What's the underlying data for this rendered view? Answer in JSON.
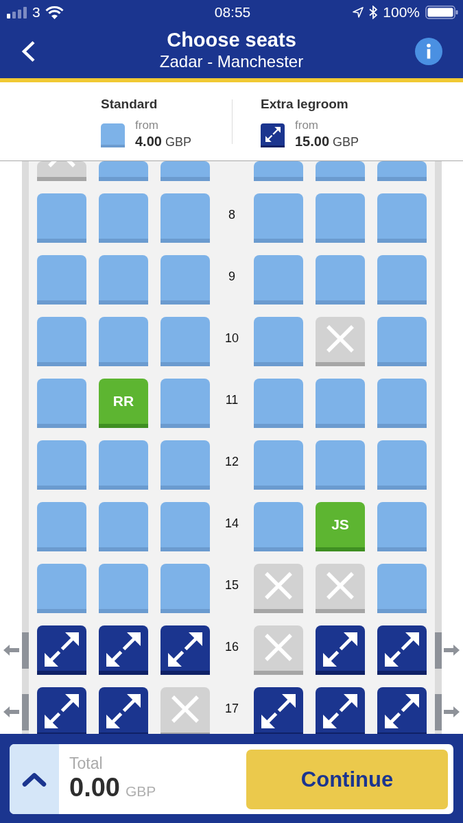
{
  "status_bar": {
    "carrier": "3",
    "time": "08:55",
    "battery": "100%"
  },
  "header": {
    "title": "Choose seats",
    "subtitle": "Zadar - Manchester"
  },
  "legend": [
    {
      "kind": "standard",
      "label": "Standard",
      "from": "from",
      "price": "4.00",
      "currency": "GBP"
    },
    {
      "kind": "extra",
      "label": "Extra legroom",
      "from": "from",
      "price": "15.00",
      "currency": "GBP"
    }
  ],
  "seat_map": {
    "rows": [
      {
        "exit": false,
        "seats": [
          {
            "kind": "unavailable"
          },
          {
            "kind": "standard"
          },
          {
            "kind": "standard"
          },
          {
            "kind": "standard"
          },
          {
            "kind": "standard"
          },
          {
            "kind": "standard"
          }
        ]
      },
      {
        "number": "8",
        "exit": false,
        "seats": [
          {
            "kind": "standard"
          },
          {
            "kind": "standard"
          },
          {
            "kind": "standard"
          },
          {
            "kind": "standard"
          },
          {
            "kind": "standard"
          },
          {
            "kind": "standard"
          }
        ]
      },
      {
        "number": "9",
        "exit": false,
        "seats": [
          {
            "kind": "standard"
          },
          {
            "kind": "standard"
          },
          {
            "kind": "standard"
          },
          {
            "kind": "standard"
          },
          {
            "kind": "standard"
          },
          {
            "kind": "standard"
          }
        ]
      },
      {
        "number": "10",
        "exit": false,
        "seats": [
          {
            "kind": "standard"
          },
          {
            "kind": "standard"
          },
          {
            "kind": "standard"
          },
          {
            "kind": "standard"
          },
          {
            "kind": "unavailable"
          },
          {
            "kind": "standard"
          }
        ]
      },
      {
        "number": "11",
        "exit": false,
        "seats": [
          {
            "kind": "standard"
          },
          {
            "kind": "passenger",
            "initials": "RR"
          },
          {
            "kind": "standard"
          },
          {
            "kind": "standard"
          },
          {
            "kind": "standard"
          },
          {
            "kind": "standard"
          }
        ]
      },
      {
        "number": "12",
        "exit": false,
        "seats": [
          {
            "kind": "standard"
          },
          {
            "kind": "standard"
          },
          {
            "kind": "standard"
          },
          {
            "kind": "standard"
          },
          {
            "kind": "standard"
          },
          {
            "kind": "standard"
          }
        ]
      },
      {
        "number": "14",
        "exit": false,
        "seats": [
          {
            "kind": "standard"
          },
          {
            "kind": "standard"
          },
          {
            "kind": "standard"
          },
          {
            "kind": "standard"
          },
          {
            "kind": "passenger",
            "initials": "JS"
          },
          {
            "kind": "standard"
          }
        ]
      },
      {
        "number": "15",
        "exit": false,
        "seats": [
          {
            "kind": "standard"
          },
          {
            "kind": "standard"
          },
          {
            "kind": "standard"
          },
          {
            "kind": "unavailable"
          },
          {
            "kind": "unavailable"
          },
          {
            "kind": "standard"
          }
        ]
      },
      {
        "number": "16",
        "exit": true,
        "seats": [
          {
            "kind": "extra"
          },
          {
            "kind": "extra"
          },
          {
            "kind": "extra"
          },
          {
            "kind": "unavailable"
          },
          {
            "kind": "extra"
          },
          {
            "kind": "extra"
          }
        ]
      },
      {
        "number": "17",
        "exit": true,
        "seats": [
          {
            "kind": "extra"
          },
          {
            "kind": "extra"
          },
          {
            "kind": "unavailable"
          },
          {
            "kind": "extra"
          },
          {
            "kind": "extra"
          },
          {
            "kind": "extra"
          }
        ]
      }
    ]
  },
  "footer": {
    "total_label": "Total",
    "total": "0.00",
    "currency": "GBP",
    "button": "Continue"
  }
}
